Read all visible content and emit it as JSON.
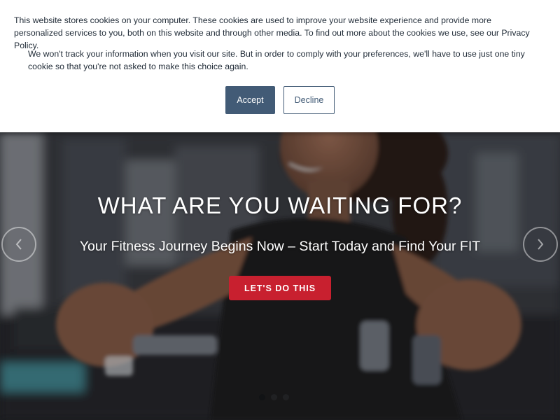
{
  "cookie_banner": {
    "text_1": "This website stores cookies on your computer. These cookies are used to improve your website experience and provide more personalized services to you, both on this website and through other media. To find out more about the cookies we use, see our Privacy Policy.",
    "text_2": "We won't track your information when you visit our site. But in order to comply with your preferences, we'll have to use just one tiny cookie so that you're not asked to make this choice again.",
    "accept_label": "Accept",
    "decline_label": "Decline"
  },
  "hero": {
    "title": "WHAT ARE YOU WAITING FOR?",
    "subtitle": "Your Fitness Journey Begins Now – Start Today and Find Your FIT",
    "cta_label": "LET'S DO THIS",
    "prev_icon": "chevron-left-icon",
    "next_icon": "chevron-right-icon",
    "slide_count": 3,
    "active_slide": 1
  },
  "colors": {
    "banner_button": "#425b76",
    "cta": "#c8202f",
    "text_dark": "#1f2a36"
  }
}
